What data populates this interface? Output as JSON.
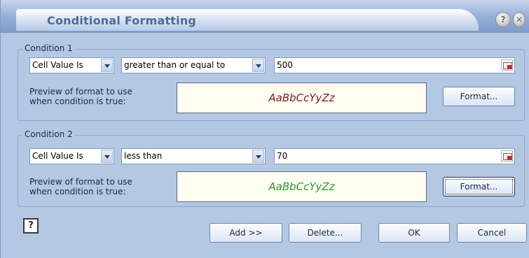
{
  "window": {
    "title": "Conditional Formatting"
  },
  "titlebar": {
    "help_glyph": "?",
    "close_glyph": "✕"
  },
  "condition1": {
    "legend": "Condition 1",
    "type": "Cell Value Is",
    "operator": "greater than or equal to",
    "value": "500",
    "preview_label_line1": "Preview of format to use",
    "preview_label_line2": "when condition is true:",
    "preview_text": "AaBbCcYyZz",
    "preview_color": "#7a1b22",
    "format_button": "Format..."
  },
  "condition2": {
    "legend": "Condition 2",
    "type": "Cell Value Is",
    "operator": "less than",
    "value": "70",
    "preview_label_line1": "Preview of format to use",
    "preview_label_line2": "when condition is true:",
    "preview_text": "AaBbCcYyZz",
    "preview_color": "#2f9a2f",
    "format_button": "Format..."
  },
  "footer": {
    "help_icon": "?",
    "add_button": "Add >>",
    "delete_button": "Delete...",
    "ok_button": "OK",
    "cancel_button": "Cancel"
  }
}
